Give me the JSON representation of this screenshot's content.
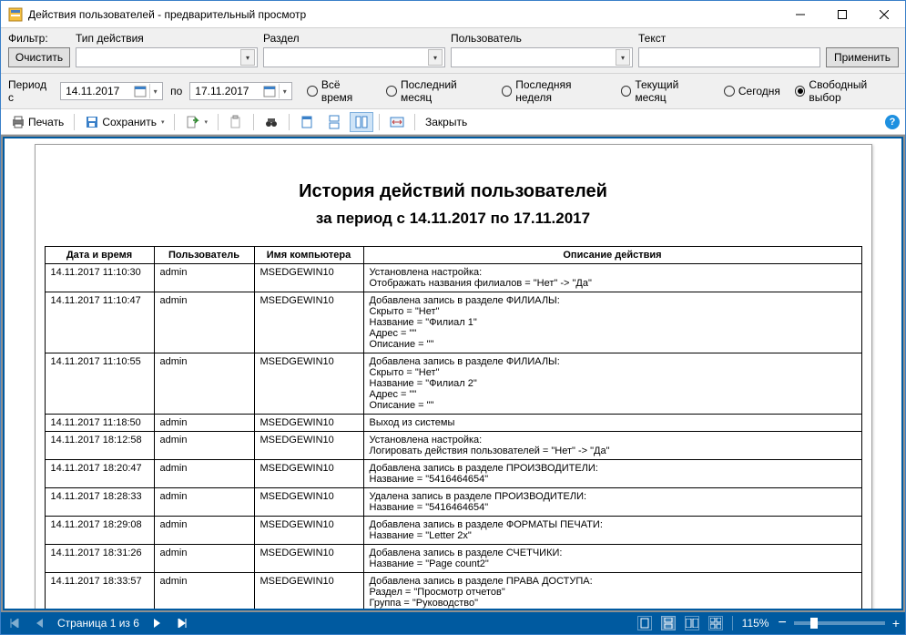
{
  "window": {
    "title": "Действия пользователей - предварительный просмотр"
  },
  "filter": {
    "label": "Фильтр:",
    "type_label": "Тип действия",
    "section_label": "Раздел",
    "user_label": "Пользователь",
    "text_label": "Текст",
    "clear": "Очистить",
    "apply": "Применить"
  },
  "period": {
    "from_label": "Период с",
    "to_label": "по",
    "from": "14.11.2017",
    "to": "17.11.2017",
    "opts": {
      "all": "Всё время",
      "last_month": "Последний месяц",
      "last_week": "Последняя неделя",
      "this_month": "Текущий месяц",
      "today": "Сегодня",
      "free": "Свободный выбор"
    },
    "selected": "free"
  },
  "toolbar": {
    "print": "Печать",
    "save": "Сохранить",
    "close": "Закрыть"
  },
  "report": {
    "title": "История действий пользователей",
    "subtitle": "за период с 14.11.2017 по 17.11.2017",
    "headers": {
      "dt": "Дата и время",
      "user": "Пользователь",
      "pc": "Имя компьютера",
      "desc": "Описание действия"
    },
    "rows": [
      {
        "dt": "14.11.2017 11:10:30",
        "user": "admin",
        "pc": "MSEDGEWIN10",
        "desc": "Установлена настройка:\nОтображать названия филиалов = \"Нет\" -> \"Да\""
      },
      {
        "dt": "14.11.2017 11:10:47",
        "user": "admin",
        "pc": "MSEDGEWIN10",
        "desc": "Добавлена запись в разделе ФИЛИАЛЫ:\nСкрыто = \"Нет\"\nНазвание = \"Филиал 1\"\nАдрес = \"\"\nОписание = \"\""
      },
      {
        "dt": "14.11.2017 11:10:55",
        "user": "admin",
        "pc": "MSEDGEWIN10",
        "desc": "Добавлена запись в разделе ФИЛИАЛЫ:\nСкрыто = \"Нет\"\nНазвание = \"Филиал 2\"\nАдрес = \"\"\nОписание = \"\""
      },
      {
        "dt": "14.11.2017 11:18:50",
        "user": "admin",
        "pc": "MSEDGEWIN10",
        "desc": "Выход из системы"
      },
      {
        "dt": "14.11.2017 18:12:58",
        "user": "admin",
        "pc": "MSEDGEWIN10",
        "desc": "Установлена настройка:\nЛогировать действия пользователей = \"Нет\" -> \"Да\""
      },
      {
        "dt": "14.11.2017 18:20:47",
        "user": "admin",
        "pc": "MSEDGEWIN10",
        "desc": "Добавлена запись в разделе ПРОИЗВОДИТЕЛИ:\nНазвание = \"5416464654\""
      },
      {
        "dt": "14.11.2017 18:28:33",
        "user": "admin",
        "pc": "MSEDGEWIN10",
        "desc": "Удалена запись в разделе ПРОИЗВОДИТЕЛИ:\nНазвание = \"5416464654\""
      },
      {
        "dt": "14.11.2017 18:29:08",
        "user": "admin",
        "pc": "MSEDGEWIN10",
        "desc": "Добавлена запись в разделе ФОРМАТЫ ПЕЧАТИ:\nНазвание = \"Letter 2x\""
      },
      {
        "dt": "14.11.2017 18:31:26",
        "user": "admin",
        "pc": "MSEDGEWIN10",
        "desc": "Добавлена запись в разделе СЧЕТЧИКИ:\nНазвание = \"Page count2\""
      },
      {
        "dt": "14.11.2017 18:33:57",
        "user": "admin",
        "pc": "MSEDGEWIN10",
        "desc": "Добавлена запись в разделе ПРАВА ДОСТУПА:\nРаздел = \"Просмотр отчетов\"\nГруппа = \"Руководство\""
      }
    ]
  },
  "status": {
    "page": "Страница 1 из 6",
    "zoom": "115%"
  }
}
